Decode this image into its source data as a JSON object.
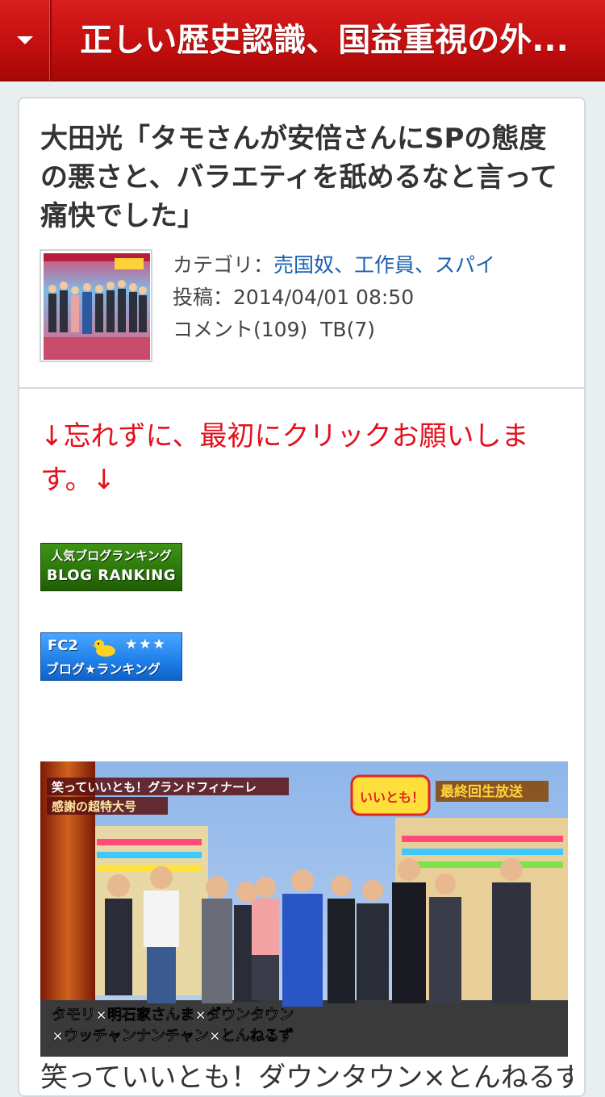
{
  "header": {
    "title": "正しい歴史認識、国益重視の外...",
    "menu_icon": "caret-down-icon",
    "color": "#c10e0e"
  },
  "post": {
    "title": "大田光「タモさんが安倍さんにSPの態度の悪さと、バラエティを舐めるなと言って痛快でした」",
    "category_label": "カテゴリ：",
    "category_value": "売国奴、工作員、スパイ",
    "posted_label": "投稿：",
    "posted_value": "2014/04/01 08:50",
    "comments": "コメント(109)",
    "trackbacks": "TB(7)"
  },
  "notice": "↓忘れずに、最初にクリックお願いします。↓",
  "banners": {
    "blog_line1": "人気ブログランキング",
    "blog_line2": "BLOG RANKING",
    "fc2_line1": "FC2",
    "fc2_stars": "★★★",
    "fc2_line2": "ブログ★ランキング"
  },
  "photo": {
    "top_title": "笑っていいとも！グランドフィナーレ",
    "top_subtitle": "感謝の超特大号",
    "logo": "いいとも！",
    "badge": "最終回生放送",
    "bottom_line1": "タモリ×明石家さんま×ダウンタウン",
    "bottom_line2": "×ウッチャンナンチャン×とんねるず"
  },
  "caption": "笑っていいとも！ダウンタウン×とんねるず×"
}
